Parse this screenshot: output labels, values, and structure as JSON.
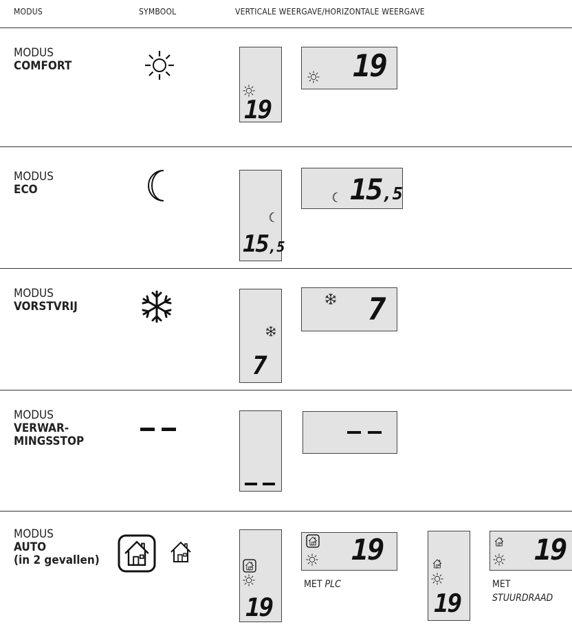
{
  "header": {
    "col_modus": "MODUS",
    "col_symbool": "SYMBOOL",
    "col_weergave": "VERTICALE WEERGAVE/HORIZONTALE WEERGAVE"
  },
  "rows": [
    {
      "prefix": "MODUS",
      "name": "COMFORT",
      "symbol": "sun-icon",
      "vertical": {
        "icon": "sun-icon",
        "value": "19"
      },
      "horizontal": {
        "icon": "sun-icon",
        "value": "19"
      }
    },
    {
      "prefix": "MODUS",
      "name": "ECO",
      "symbol": "moon-icon",
      "vertical": {
        "icon": "moon-icon",
        "value": "15",
        "decimal": ",5"
      },
      "horizontal": {
        "icon": "moon-icon",
        "value": "15",
        "decimal": ",5"
      }
    },
    {
      "prefix": "MODUS",
      "name": "VORSTVRIJ",
      "symbol": "snowflake-icon",
      "vertical": {
        "icon": "snowflake-icon",
        "value": "7"
      },
      "horizontal": {
        "icon": "snowflake-icon",
        "value": "7"
      }
    },
    {
      "prefix": "MODUS",
      "name_line1": "VERWAR-",
      "name_line2": "MINGSSTOP",
      "symbol": "dash-icon",
      "vertical": {
        "value": "--"
      },
      "horizontal": {
        "value": "--"
      }
    },
    {
      "prefix": "MODUS",
      "name": "AUTO",
      "subtitle": "(in 2 gevallen)",
      "symbols": [
        "framed-house-icon",
        "house-icon"
      ],
      "plc": {
        "vertical_value": "19",
        "horizontal_value": "19",
        "caption_prefix": "MET",
        "caption_em": "PLC"
      },
      "wire": {
        "vertical_value": "19",
        "horizontal_value": "19",
        "caption_prefix": "MET",
        "caption_em": "STUURDRAAD"
      }
    }
  ]
}
